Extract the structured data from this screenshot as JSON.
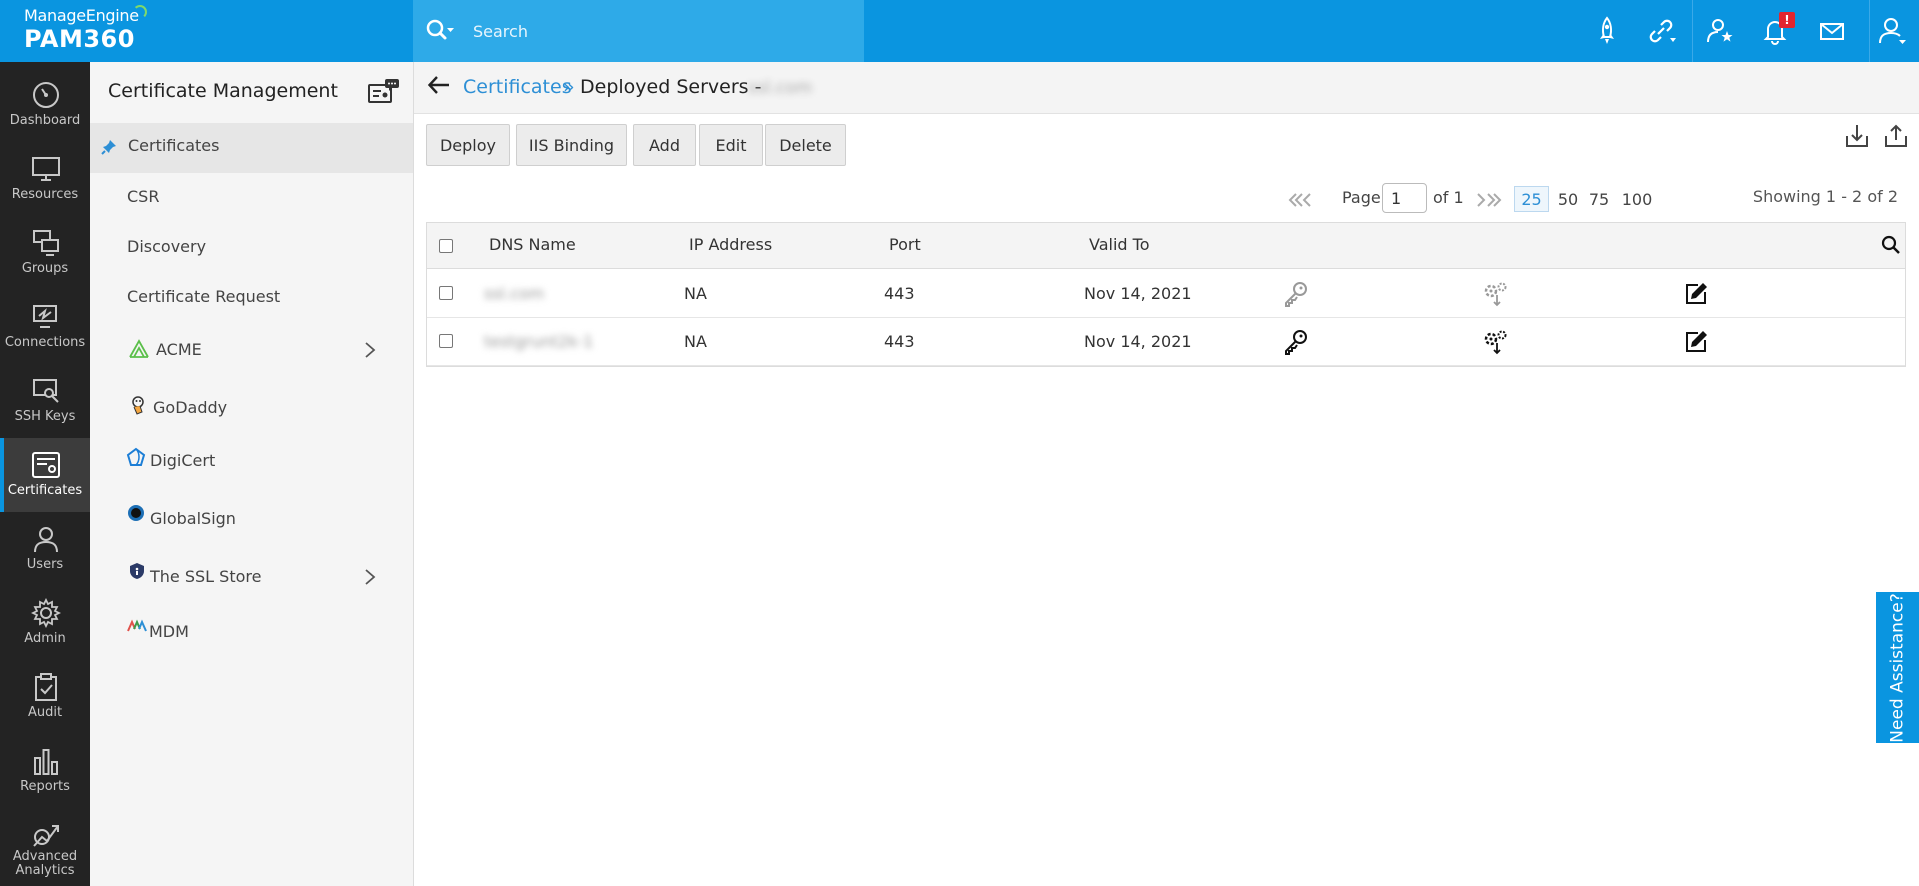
{
  "brand": {
    "company": "ManageEngine",
    "product": "PAM360"
  },
  "search": {
    "placeholder": "Search"
  },
  "topbar": {
    "notification_badge": "!"
  },
  "rail": {
    "items": [
      {
        "label": "Dashboard"
      },
      {
        "label": "Resources"
      },
      {
        "label": "Groups"
      },
      {
        "label": "Connections"
      },
      {
        "label": "SSH Keys"
      },
      {
        "label": "Certificates"
      },
      {
        "label": "Users"
      },
      {
        "label": "Admin"
      },
      {
        "label": "Audit"
      },
      {
        "label": "Reports"
      },
      {
        "label": "Advanced"
      },
      {
        "label": "Analytics"
      }
    ]
  },
  "subnav": {
    "title": "Certificate Management",
    "items": [
      {
        "label": "Certificates"
      },
      {
        "label": "CSR"
      },
      {
        "label": "Discovery"
      },
      {
        "label": "Certificate Request"
      },
      {
        "label": "ACME"
      },
      {
        "label": "GoDaddy"
      },
      {
        "label": "DigiCert"
      },
      {
        "label": "GlobalSign"
      },
      {
        "label": "The SSL Store"
      },
      {
        "label": "MDM"
      }
    ]
  },
  "breadcrumb": {
    "parent": "Certificates",
    "separator": "»",
    "current": "Deployed Servers -",
    "domain_blurred": "ssl.com"
  },
  "toolbar": {
    "deploy": "Deploy",
    "iis_binding": "IIS Binding",
    "add": "Add",
    "edit": "Edit",
    "delete": "Delete"
  },
  "pager": {
    "page_label": "Page",
    "page_value": "1",
    "of_label": "of 1",
    "sizes": [
      "25",
      "50",
      "75",
      "100"
    ],
    "selected_size": "25",
    "showing": "Showing 1 - 2 of 2"
  },
  "table": {
    "columns": [
      "DNS Name",
      "IP Address",
      "Port",
      "Valid To"
    ],
    "rows": [
      {
        "dns": "ssl.com",
        "ip": "NA",
        "port": "443",
        "valid_to": "Nov 14, 2021"
      },
      {
        "dns": "testgrunt2k-1",
        "ip": "NA",
        "port": "443",
        "valid_to": "Nov 14, 2021"
      }
    ]
  },
  "assist": {
    "label": "Need Assistance?"
  },
  "colors": {
    "brand_blue": "#0a95e0",
    "rail_bg": "#232323",
    "link_blue": "#2d8fd5"
  }
}
